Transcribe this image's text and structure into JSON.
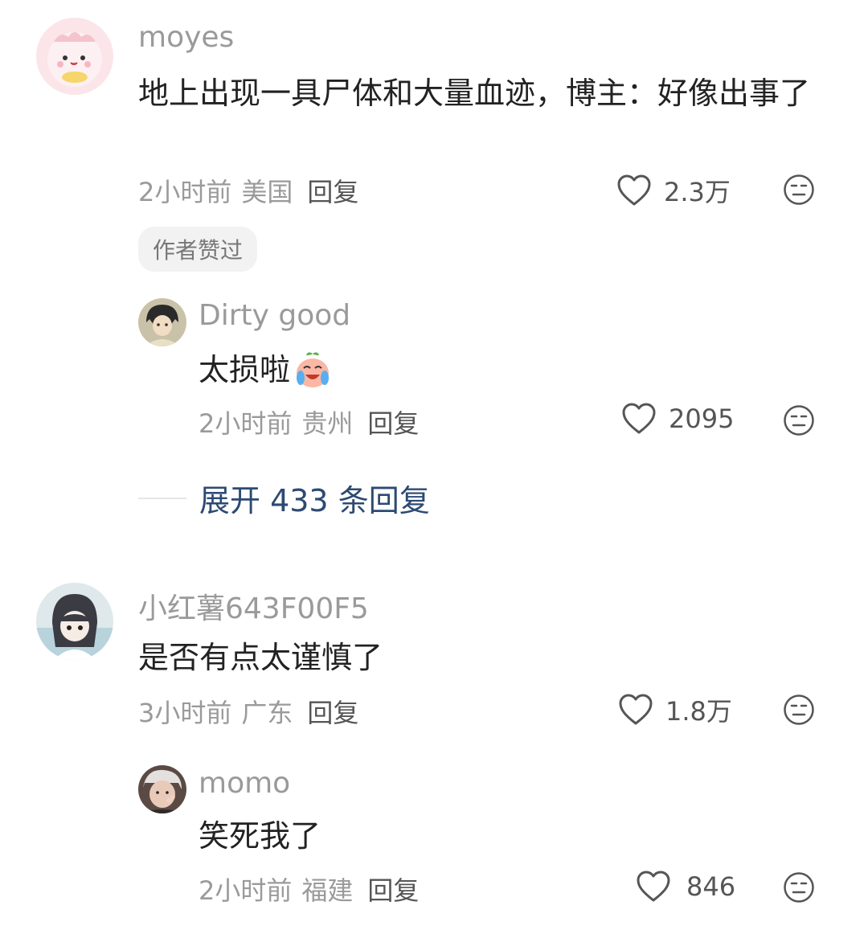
{
  "comments": [
    {
      "username": "moyes",
      "text": "地上出现一具尸体和大量血迹，博主：好像出事了",
      "time": "2小时前",
      "location": "美国",
      "reply_label": "回复",
      "likes": "2.3万",
      "badge": "作者赞过",
      "replies": [
        {
          "username": "Dirty good",
          "text": "太损啦",
          "emoji": "crying-laughing-peach-emoji",
          "time": "2小时前",
          "location": "贵州",
          "reply_label": "回复",
          "likes": "2095"
        }
      ],
      "expand_label": "展开 433 条回复"
    },
    {
      "username": "小红薯643F00F5",
      "text": "是否有点太谨慎了",
      "time": "3小时前",
      "location": "广东",
      "reply_label": "回复",
      "likes": "1.8万",
      "replies": [
        {
          "username": "momo",
          "text": "笑死我了",
          "time": "2小时前",
          "location": "福建",
          "reply_label": "回复",
          "likes": "846"
        }
      ]
    }
  ],
  "icons": {
    "like": "heart-outline-icon",
    "dislike": "unamused-face-icon"
  },
  "colors": {
    "username": "#9a9a9a",
    "expand_link": "#2d4a73",
    "badge_bg": "#f2f2f2"
  }
}
